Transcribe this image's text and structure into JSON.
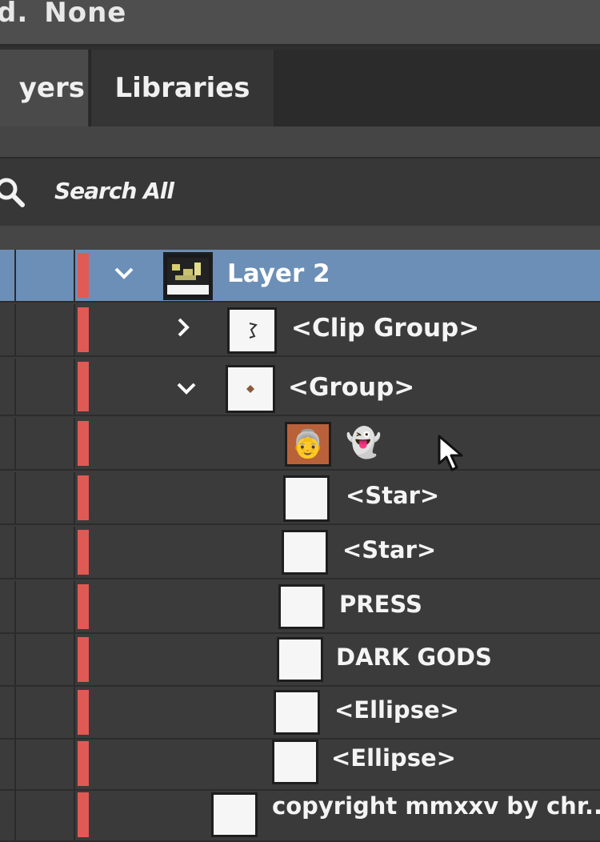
{
  "topbar": {
    "prefix": "d.",
    "value": "None"
  },
  "tabs": {
    "layers": "yers",
    "libraries": "Libraries"
  },
  "search": {
    "placeholder": "Search All"
  },
  "layers": [
    {
      "name": "Layer 2",
      "selected": true,
      "caret": "expanded"
    },
    {
      "name": "<Clip Group>",
      "caret": "collapsed"
    },
    {
      "name": "<Group>",
      "caret": "expanded"
    },
    {
      "name": "",
      "emoji": "👵",
      "ghost": "👻"
    },
    {
      "name": "<Star>"
    },
    {
      "name": "<Star>"
    },
    {
      "name": "PRESS"
    },
    {
      "name": "DARK GODS"
    },
    {
      "name": "<Ellipse>"
    },
    {
      "name": "<Ellipse>"
    },
    {
      "name": "copyright mmxxv by chr..."
    }
  ],
  "colors": {
    "layer_color": "#e05a55",
    "selection": "#6b8fb7"
  }
}
